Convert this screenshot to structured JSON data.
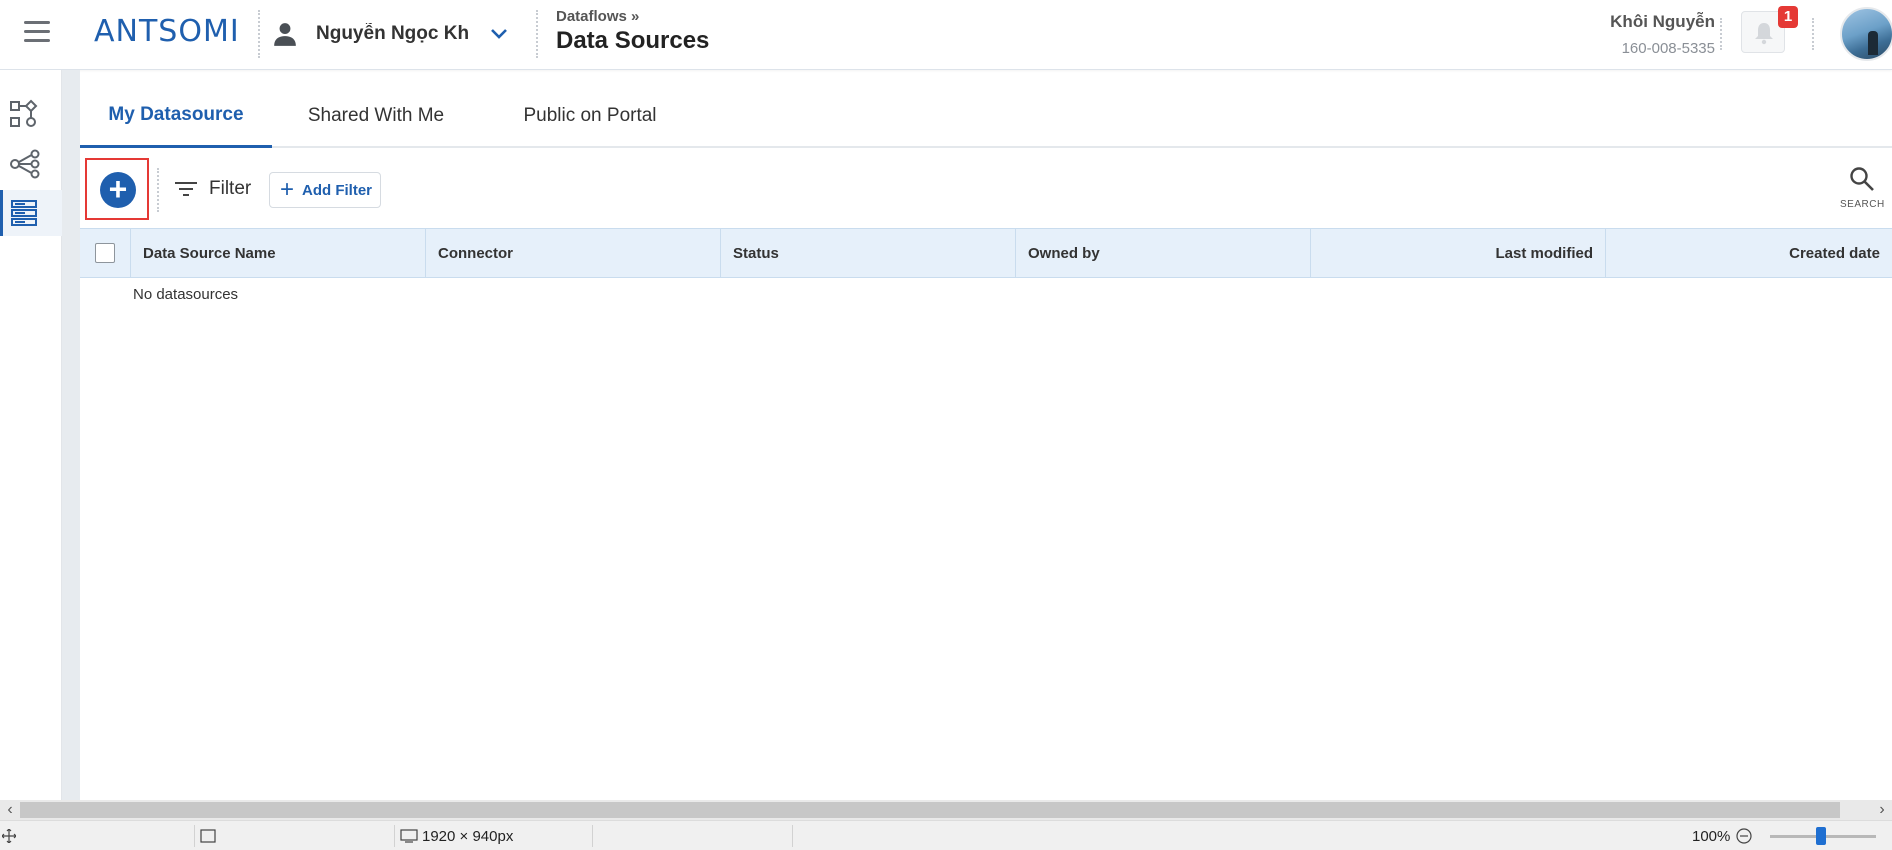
{
  "header": {
    "logo_text": "ANTSOMI",
    "account_name": "Nguyễn Ngọc Kh...",
    "breadcrumb_parent": "Dataflows »",
    "page_title": "Data Sources",
    "user_name": "Khôi Nguyễn",
    "user_phone": "160-008-5335",
    "notification_count": "1"
  },
  "sidebar": {
    "items": [
      {
        "icon": "workflow-icon"
      },
      {
        "icon": "share-nodes-icon"
      },
      {
        "icon": "datasource-list-icon",
        "active": true
      }
    ]
  },
  "tabs": [
    {
      "label": "My Datasource",
      "active": true
    },
    {
      "label": "Shared With Me"
    },
    {
      "label": "Public on Portal"
    }
  ],
  "toolbar": {
    "add_label": "+",
    "filter_label": "Filter",
    "add_filter_label": "Add Filter",
    "search_label": "SEARCH"
  },
  "table": {
    "columns": [
      "Data Source Name",
      "Connector",
      "Status",
      "Owned by",
      "Last modified",
      "Created date"
    ],
    "empty_message": "No datasources"
  },
  "statusbar": {
    "dimensions": "1920 × 940px",
    "zoom": "100%"
  },
  "colors": {
    "accent": "#1f5fae",
    "badge": "#e53935",
    "table_header": "#e6f0fa"
  }
}
